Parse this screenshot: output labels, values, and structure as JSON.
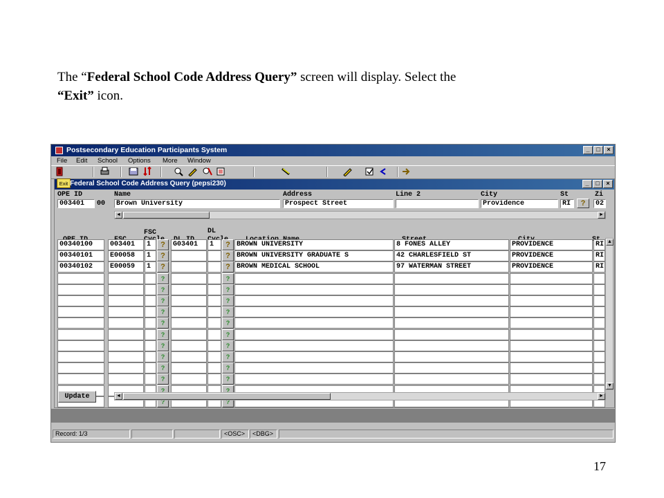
{
  "caption": {
    "part1": "The “",
    "bold1": "Federal School Code Address Query”",
    "part2": " screen will display.  Select the",
    "bold2": "“Exit”",
    "part3": " icon."
  },
  "page_number": "17",
  "app": {
    "title": "Postsecondary Education Participants System",
    "menu": [
      "File",
      "Edit",
      "School",
      "Options",
      "More",
      "Window"
    ]
  },
  "window_controls": {
    "minimize": "_",
    "maximize": "□",
    "close": "×"
  },
  "inner": {
    "exit_label": "Exit",
    "title": "Federal School Code Address Query (pepsi230)"
  },
  "header": {
    "labels": {
      "ope_id": "OPE ID",
      "name": "Name",
      "address": "Address",
      "line2": "Line 2",
      "city": "City",
      "st": "St",
      "zip": "Zi"
    },
    "values": {
      "ope_id": "003401",
      "ope_suffix": "00",
      "name": "Brown University",
      "address": "Prospect Street",
      "line2": "",
      "city": "Providence",
      "st": "RI",
      "zip": "02"
    }
  },
  "grid": {
    "headers": {
      "ope_id": "OPE ID",
      "fsc": "FSC",
      "fsc_cycle_top": "FSC",
      "fsc_cycle_bottom": "Cycle",
      "dl_id": "DL ID",
      "dl_cycle_top": "DL",
      "dl_cycle_bottom": "Cycle",
      "location_name": "Location Name",
      "street": "Street",
      "city": "City",
      "st": "St"
    },
    "rows": [
      {
        "ope_id": "00340100",
        "fsc": "003401",
        "fsc_cycle": "1",
        "dl_id": "G03401",
        "dl_cycle": "1",
        "location_name": "BROWN UNIVERSITY",
        "street": "8 FONES ALLEY",
        "city": "PROVIDENCE",
        "st": "RI"
      },
      {
        "ope_id": "00340101",
        "fsc": "E00058",
        "fsc_cycle": "1",
        "dl_id": "",
        "dl_cycle": "",
        "location_name": "BROWN UNIVERSITY GRADUATE S",
        "street": "42 CHARLESFIELD ST",
        "city": "PROVIDENCE",
        "st": "RI"
      },
      {
        "ope_id": "00340102",
        "fsc": "E00059",
        "fsc_cycle": "1",
        "dl_id": "",
        "dl_cycle": "",
        "location_name": "BROWN MEDICAL SCHOOL",
        "street": "97 WATERMAN STREET",
        "city": "PROVIDENCE",
        "st": "RI"
      }
    ],
    "empty_rows": 12
  },
  "update_label": "Update",
  "status": {
    "record": "Record: 1/3",
    "osc": "<OSC>",
    "dbg": "<DBG>"
  },
  "icons": {
    "query": "question-mark-icon",
    "exit": "exit-icon",
    "scroll_left": "◄",
    "scroll_right": "►",
    "scroll_up": "▲",
    "scroll_down": "▼"
  }
}
